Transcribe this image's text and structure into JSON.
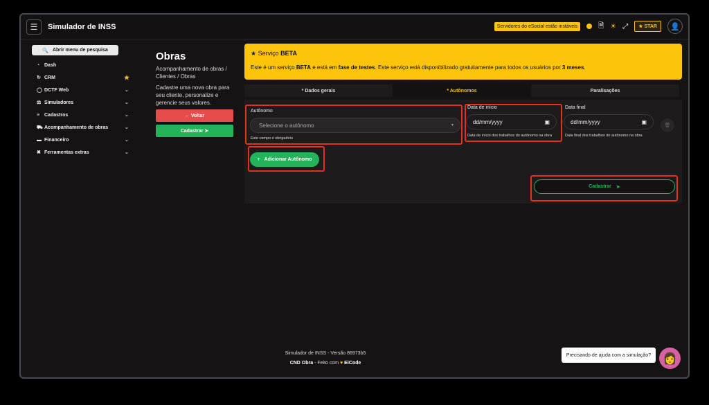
{
  "topbar": {
    "app_title": "Simulador de INSS",
    "warning": "Servidores do eSocial estão instáveis",
    "star_label": "STAR"
  },
  "sidebar": {
    "search_label": "Abrir menu de pesquisa",
    "items": [
      {
        "label": "Dash"
      },
      {
        "label": "CRM"
      },
      {
        "label": "DCTF Web"
      },
      {
        "label": "Simuladores"
      },
      {
        "label": "Cadastros"
      },
      {
        "label": "Acompanhamento de obras"
      },
      {
        "label": "Financeiro"
      },
      {
        "label": "Ferramentas extras"
      }
    ]
  },
  "page": {
    "title": "Obras",
    "breadcrumb": "Acompanhamento de obras / Clientes / Obras",
    "description": "Cadastre uma nova obra para seu cliente, personalize e gerencie seus valores.",
    "back_label": "Voltar",
    "register_label": "Cadastrar"
  },
  "beta": {
    "title_prefix": "Serviço ",
    "title_bold": "BETA",
    "body_1": "Este é um serviço ",
    "body_2": "BETA",
    "body_3": " e está em ",
    "body_4": "fase de testes",
    "body_5": ". Este serviço está disponibilizado gratuitamente para todos os usuários por ",
    "body_6": "3 meses",
    "body_7": "."
  },
  "tabs": [
    {
      "label": "* Dados gerais"
    },
    {
      "label": "* Autônomos"
    },
    {
      "label": "Paralisações"
    }
  ],
  "form": {
    "autonomo_label": "Autônomo",
    "autonomo_placeholder": "Selecione o autônomo",
    "autonomo_error": "Este campo é obrigatório",
    "inicio_label": "Data de início",
    "inicio_value": "dd/mm/yyyy",
    "inicio_hint": "Data de início dos trabalhos do autônomo na obra",
    "final_label": "Data final",
    "final_value": "dd/mm/yyyy",
    "final_hint": "Data final dos trabalhos do autônomo na obra",
    "add_label": "Adicionar Autônomo",
    "submit_label": "Cadastrar"
  },
  "footer": {
    "version": "Simulador de INSS - Versão 86973b5",
    "product": "CND Obra",
    "sep": " - ",
    "made_with": "Feito com ",
    "brand": "EiCode"
  },
  "help": {
    "text": "Precisando de ajuda com a simulação?"
  }
}
